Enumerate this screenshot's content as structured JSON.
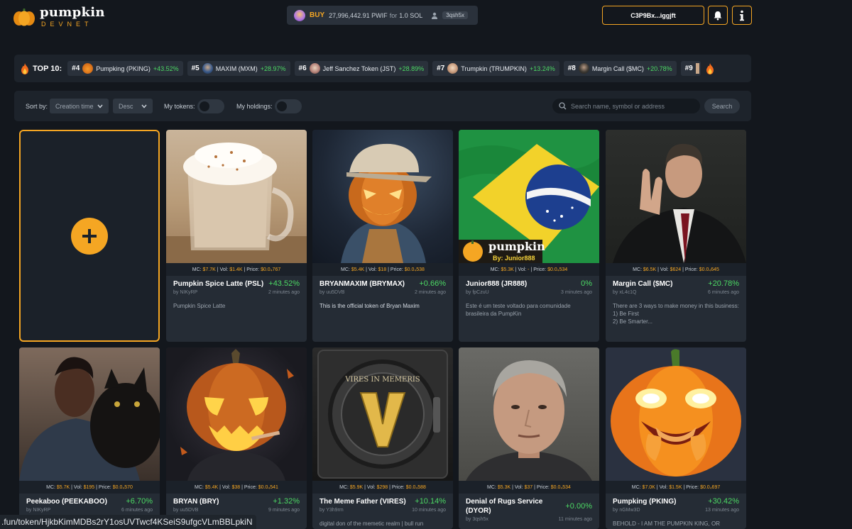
{
  "header": {
    "logo_name": "pumpkin",
    "logo_sub": "DEVNET",
    "buy_label": "BUY",
    "buy_amount": "27,996,442.91 PWIF",
    "buy_for": "for",
    "buy_sol": "1.0 SOL",
    "buy_user": "3qsh5x",
    "wallet": "C3P9Bx...iggjft",
    "bell_icon": "bell-icon",
    "info_icon": "info-icon"
  },
  "top10": {
    "title": "TOP 10:",
    "items": [
      {
        "rank": "#4",
        "name": "Pumpking (PKING)",
        "change": "+43.52%"
      },
      {
        "rank": "#5",
        "name": "MAXIM (MXM)",
        "change": "+28.97%"
      },
      {
        "rank": "#6",
        "name": "Jeff Sanchez Token (JST)",
        "change": "+28.89%"
      },
      {
        "rank": "#7",
        "name": "Trumpkin (TRUMPKIN)",
        "change": "+13.24%"
      },
      {
        "rank": "#8",
        "name": "Margin Call ($MC)",
        "change": "+20.78%"
      },
      {
        "rank": "#9",
        "name": "",
        "change": ""
      }
    ]
  },
  "filters": {
    "sort_label": "Sort by:",
    "sort_value": "Creation time",
    "order_value": "Desc",
    "my_tokens_label": "My tokens:",
    "my_holdings_label": "My holdings:",
    "search_placeholder": "Search name, symbol or address",
    "search_button": "Search"
  },
  "cards": [
    {
      "mc": "$7.7K",
      "vol": "$1.4K",
      "price": "$0.0₄767",
      "name": "Pumpkin Spice Latte (PSL)",
      "change": "+43.52%",
      "by": "by NIKyRP",
      "time": "2 minutes ago",
      "desc": "Pumpkin Spice Latte"
    },
    {
      "mc": "$5.4K",
      "vol": "$18",
      "price": "$0.0₄538",
      "name": "BRYANMAXIM (BRYMAX)",
      "change": "+0.66%",
      "by": "by uu5DVB",
      "time": "2 minutes ago",
      "desc": "This is the official token of Bryan Maxim"
    },
    {
      "mc": "$5.3K",
      "vol": "-",
      "price": "$0.0₄534",
      "name": "Junior888 (JR888)",
      "change": "0%",
      "by": "by fpCzuU",
      "time": "3 minutes ago",
      "desc": "Este é um teste voltado para comunidade brasileira da PumpKin",
      "overlay_title": "pumpkin",
      "overlay_sub": "By: Junior888"
    },
    {
      "mc": "$6.5K",
      "vol": "$624",
      "price": "$0.0₄645",
      "name": "Margin Call ($MC)",
      "change": "+20.78%",
      "by": "by xL4c1Q",
      "time": "6 minutes ago",
      "desc": "There are 3 ways to make money in this business:\n1) Be First\n2) Be Smarter..."
    },
    {
      "mc": "$5.7K",
      "vol": "$195",
      "price": "$0.0₄570",
      "name": "Peekaboo (PEEKABOO)",
      "change": "+6.70%",
      "by": "by NIKyRP",
      "time": "6 minutes ago",
      "desc": ""
    },
    {
      "mc": "$5.4K",
      "vol": "$38",
      "price": "$0.0₄541",
      "name": "BRYAN (BRY)",
      "change": "+1.32%",
      "by": "by uu5DVB",
      "time": "9 minutes ago",
      "desc": "Bryan Maxim The"
    },
    {
      "mc": "$5.9K",
      "vol": "$298",
      "price": "$0.0₄588",
      "name": "The Meme Father (VIRES)",
      "change": "+10.14%",
      "by": "by Y3h9rm",
      "time": "10 minutes ago",
      "desc": "digital don of the memetic realm | bull run",
      "img_text": "VIRES IN MEMERIS"
    },
    {
      "mc": "$5.3K",
      "vol": "$37",
      "price": "$0.0₄534",
      "name": "Denial of Rugs Service (DYOR)",
      "change": "+0.00%",
      "by": "by 3qsh5x",
      "time": "11 minutes ago",
      "desc": ""
    },
    {
      "mc": "$7.0K",
      "vol": "$1.5K",
      "price": "$0.0₄697",
      "name": "Pumpking (PKING)",
      "change": "+30.42%",
      "by": "by nGMw3D",
      "time": "13 minutes ago",
      "desc": "BEHOLD - I AM THE PUMPKIN KING, OR"
    }
  ],
  "stat_labels": {
    "mc": "MC:",
    "vol": "Vol:",
    "price": "Price:"
  },
  "url_tooltip": ".fun/token/HjkbKimMDBs2rY1osUVTwcf4KSeiS9ufgcVLmBBLpkiN",
  "colors": {
    "accent": "#f5a623",
    "positive": "#4cd964",
    "background": "#13171d",
    "card": "#252c35"
  }
}
